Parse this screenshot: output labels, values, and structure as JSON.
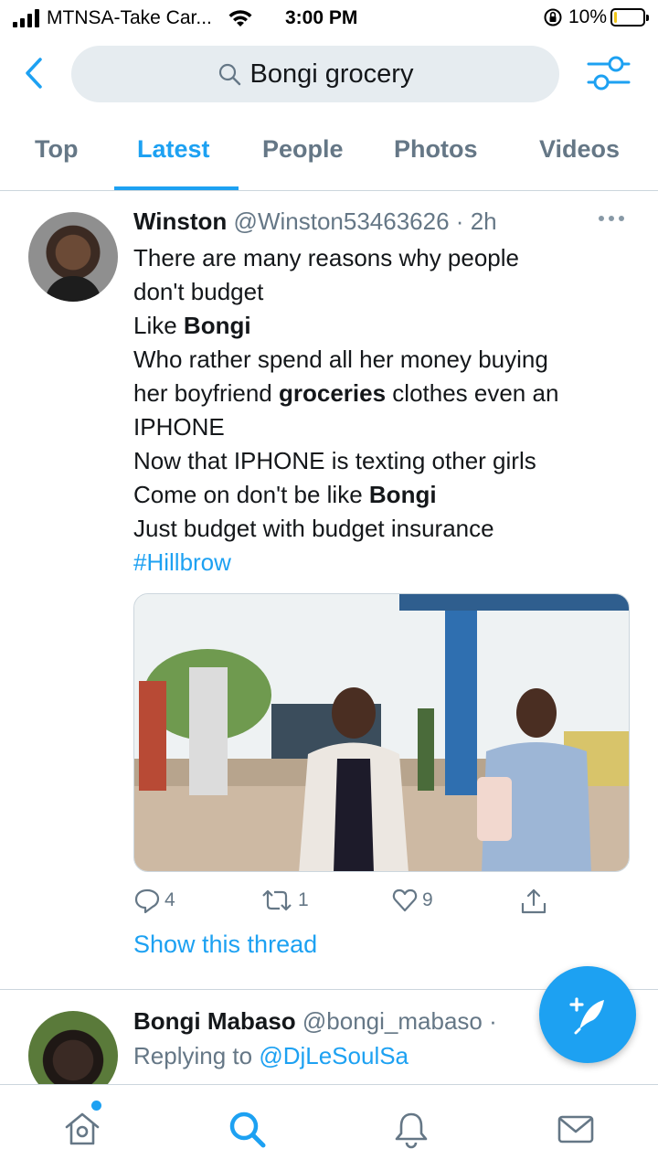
{
  "status_bar": {
    "carrier": "MTNSA-Take Car...",
    "time": "3:00 PM",
    "battery": "10%",
    "battery_level": 0.1
  },
  "search": {
    "query": "Bongi grocery",
    "icons": {
      "back": "chevron-left-icon",
      "search": "search-icon",
      "filter": "sliders-icon"
    }
  },
  "tabs": [
    {
      "label": "Top",
      "active": false
    },
    {
      "label": "Latest",
      "active": true
    },
    {
      "label": "People",
      "active": false
    },
    {
      "label": "Photos",
      "active": false
    },
    {
      "label": "Videos",
      "active": false
    }
  ],
  "tweet1": {
    "name": "Winston",
    "handle": "@Winston53463626",
    "separator": "·",
    "time": "2h",
    "lines": {
      "l1": "There are many reasons why people",
      "l2": "don't budget",
      "l3_a": "Like ",
      "l3_b": "Bongi",
      "l4": "Who rather spend all her money buying",
      "l5_a": "her boyfriend ",
      "l5_b": "groceries",
      "l5_c": " clothes even an",
      "l6": "IPHONE",
      "l7": "Now that IPHONE is texting other girls",
      "l8_a": "Come on don't be like ",
      "l8_b": "Bongi",
      "l9": "Just budget with budget insurance",
      "hashtag": "#Hillbrow"
    },
    "actions": {
      "replies": "4",
      "retweets": "1",
      "likes": "9"
    },
    "show_thread": "Show this thread"
  },
  "tweet2": {
    "name": "Bongi Mabaso",
    "handle": "@bongi_mabaso",
    "separator": "·",
    "reply_prefix": "Replying to ",
    "reply_mention": "@DjLeSoulSa"
  },
  "colors": {
    "accent": "#1da1f2",
    "secondary_text": "#657786",
    "divider": "#ccd6dd"
  }
}
